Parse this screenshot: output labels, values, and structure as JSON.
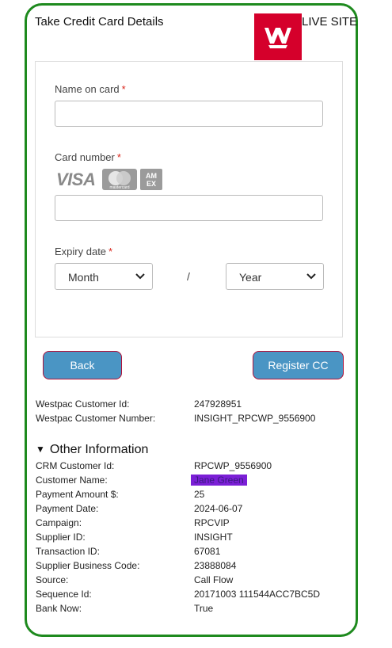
{
  "header": {
    "title": "Take Credit Card Details",
    "site_label": "LIVE SITE"
  },
  "form": {
    "name_label": "Name on card",
    "card_number_label": "Card number",
    "expiry_label": "Expiry date",
    "required_mark": "*",
    "month_value": "Month",
    "year_value": "Year",
    "slash": "/",
    "card_brands": [
      "visa-logo",
      "mastercard-logo",
      "amex-logo"
    ],
    "visa_text": "VISA",
    "mastercard_text": "mastercard",
    "amex_text": "AM EX"
  },
  "buttons": {
    "back": "Back",
    "register": "Register CC"
  },
  "customer": [
    {
      "key": "Westpac Customer Id:",
      "value": "247928951"
    },
    {
      "key": "Westpac Customer Number:",
      "value": "INSIGHT_RPCWP_9556900"
    }
  ],
  "other": {
    "title": "Other Information",
    "rows": [
      {
        "key": "CRM Customer Id:",
        "value": "RPCWP_9556900"
      },
      {
        "key": "Customer Name:",
        "value": "Jane Green"
      },
      {
        "key": "Payment Amount $:",
        "value": "25"
      },
      {
        "key": "Payment Date:",
        "value": "2024-06-07"
      },
      {
        "key": "Campaign:",
        "value": "RPCVIP"
      },
      {
        "key": "Supplier ID:",
        "value": "INSIGHT"
      },
      {
        "key": "Transaction ID:",
        "value": "67081"
      },
      {
        "key": "Supplier Business Code:",
        "value": "23888084"
      },
      {
        "key": "Source:",
        "value": "Call Flow"
      },
      {
        "key": "Sequence Id:",
        "value": "20171003 111544ACC7BC5D"
      },
      {
        "key": "Bank Now:",
        "value": "True"
      }
    ]
  },
  "colors": {
    "frame": "#1e8a1e",
    "button": "#4a95c4",
    "button_border": "#b0123a",
    "logo": "#d5002b",
    "redaction": "#7b1fd6"
  }
}
